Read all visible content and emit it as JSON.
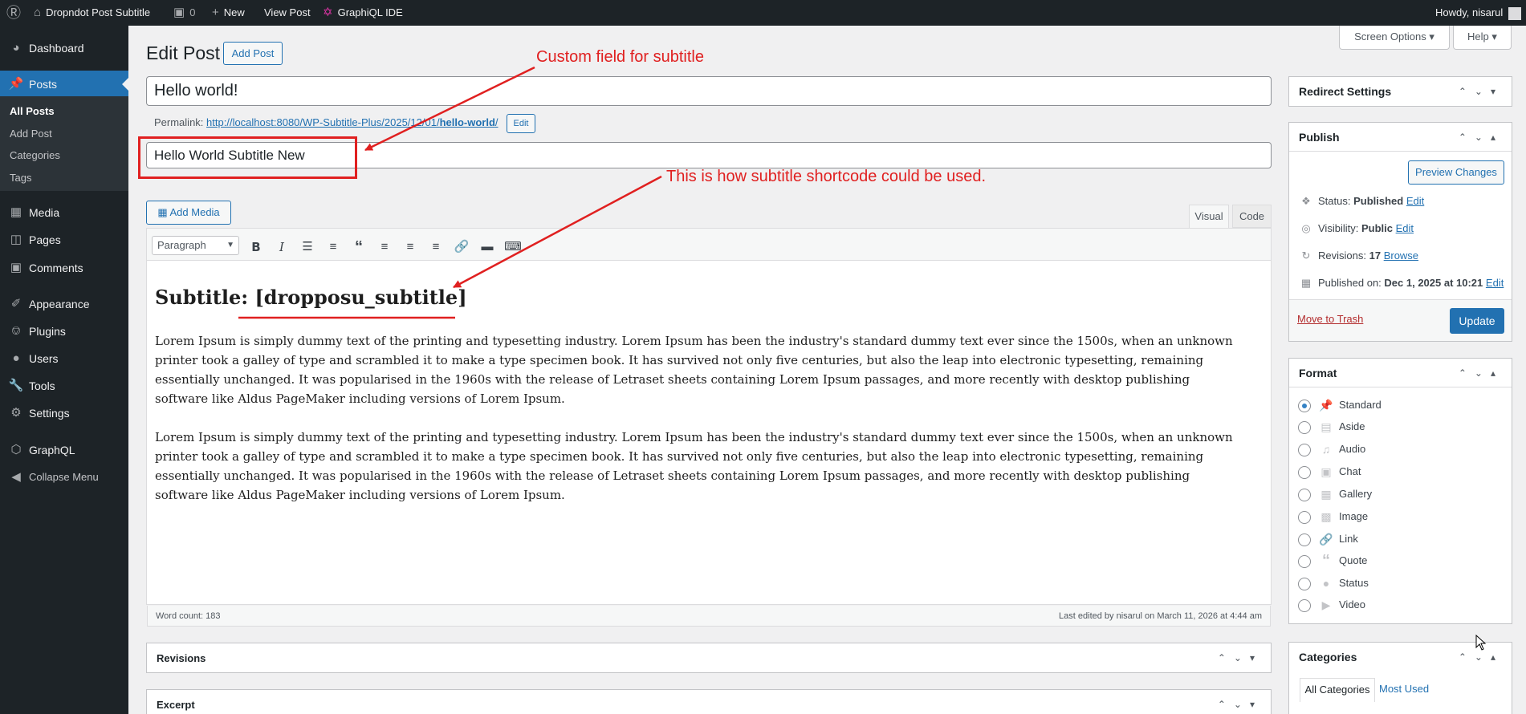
{
  "admin_bar": {
    "site_name": "Dropndot Post Subtitle",
    "comments_count": "0",
    "new_label": "New",
    "view_post_label": "View Post",
    "graphiql_label": "GraphiQL IDE",
    "greeting": "Howdy, nisarul"
  },
  "sidebar": {
    "items": [
      {
        "label": "Dashboard",
        "icon": "dashboard-icon"
      },
      {
        "label": "Posts",
        "icon": "pin-icon"
      },
      {
        "label": "Media",
        "icon": "media-icon"
      },
      {
        "label": "Pages",
        "icon": "pages-icon"
      },
      {
        "label": "Comments",
        "icon": "comments-icon"
      },
      {
        "label": "Appearance",
        "icon": "appearance-icon"
      },
      {
        "label": "Plugins",
        "icon": "plugins-icon"
      },
      {
        "label": "Users",
        "icon": "users-icon"
      },
      {
        "label": "Tools",
        "icon": "tools-icon"
      },
      {
        "label": "Settings",
        "icon": "settings-icon"
      },
      {
        "label": "GraphQL",
        "icon": "graphql-icon"
      },
      {
        "label": "Collapse Menu",
        "icon": "collapse-icon"
      }
    ],
    "submenu": [
      "All Posts",
      "Add Post",
      "Categories",
      "Tags"
    ]
  },
  "header": {
    "title": "Edit Post",
    "add_post_label": "Add Post",
    "screen_options_label": "Screen Options",
    "help_label": "Help"
  },
  "post": {
    "title": "Hello world!",
    "permalink_label": "Permalink:",
    "permalink_base": "http://localhost:8080/WP-Subtitle-Plus/2025/12/01/",
    "permalink_slug": "hello-world",
    "permalink_trailing": "/",
    "permalink_edit_label": "Edit",
    "subtitle": "Hello World Subtitle New"
  },
  "editor": {
    "add_media_label": "Add Media",
    "tab_visual": "Visual",
    "tab_code": "Code",
    "format_select": "Paragraph",
    "heading": "Subtitle: [dropposu_subtitle]",
    "paragraphs": [
      "Lorem Ipsum is simply dummy text of the printing and typesetting industry. Lorem Ipsum has been the industry's standard dummy text ever since the 1500s, when an unknown printer took a galley of type and scrambled it to make a type specimen book. It has survived not only five centuries, but also the leap into electronic typesetting, remaining essentially unchanged. It was popularised in the 1960s with the release of Letraset sheets containing Lorem Ipsum passages, and more recently with desktop publishing software like Aldus PageMaker including versions of Lorem Ipsum.",
      "Lorem Ipsum is simply dummy text of the printing and typesetting industry. Lorem Ipsum has been the industry's standard dummy text ever since the 1500s, when an unknown printer took a galley of type and scrambled it to make a type specimen book. It has survived not only five centuries, but also the leap into electronic typesetting, remaining essentially unchanged. It was popularised in the 1960s with the release of Letraset sheets containing Lorem Ipsum passages, and more recently with desktop publishing software like Aldus PageMaker including versions of Lorem Ipsum."
    ],
    "word_count": "Word count: 183",
    "last_edited": "Last edited by nisarul on March 11, 2026 at 4:44 am"
  },
  "metaboxes": {
    "revisions": "Revisions",
    "excerpt": "Excerpt"
  },
  "right": {
    "redirect_title": "Redirect Settings",
    "publish": {
      "title": "Publish",
      "preview_label": "Preview Changes",
      "status_label": "Status:",
      "status_value": "Published",
      "visibility_label": "Visibility:",
      "visibility_value": "Public",
      "revisions_label": "Revisions:",
      "revisions_value": "17",
      "browse_label": "Browse",
      "published_label": "Published on:",
      "published_value": "Dec 1, 2025 at 10:21",
      "edit_label": "Edit",
      "trash_label": "Move to Trash",
      "update_label": "Update"
    },
    "format": {
      "title": "Format",
      "options": [
        {
          "label": "Standard",
          "icon": "pin-icon",
          "selected": true
        },
        {
          "label": "Aside",
          "icon": "aside-icon",
          "selected": false
        },
        {
          "label": "Audio",
          "icon": "audio-icon",
          "selected": false
        },
        {
          "label": "Chat",
          "icon": "chat-icon",
          "selected": false
        },
        {
          "label": "Gallery",
          "icon": "gallery-icon",
          "selected": false
        },
        {
          "label": "Image",
          "icon": "image-icon",
          "selected": false
        },
        {
          "label": "Link",
          "icon": "link-icon",
          "selected": false
        },
        {
          "label": "Quote",
          "icon": "quote-icon",
          "selected": false
        },
        {
          "label": "Status",
          "icon": "status-icon",
          "selected": false
        },
        {
          "label": "Video",
          "icon": "video-icon",
          "selected": false
        }
      ]
    },
    "categories": {
      "title": "Categories",
      "tab_all": "All Categories",
      "tab_most_used": "Most Used"
    }
  },
  "annotations": {
    "custom_field": "Custom field for subtitle",
    "shortcode": "This is how subtitle shortcode could be used."
  },
  "colors": {
    "admin_dark": "#1d2327",
    "accent": "#2271b1",
    "annotation": "#e02020"
  }
}
